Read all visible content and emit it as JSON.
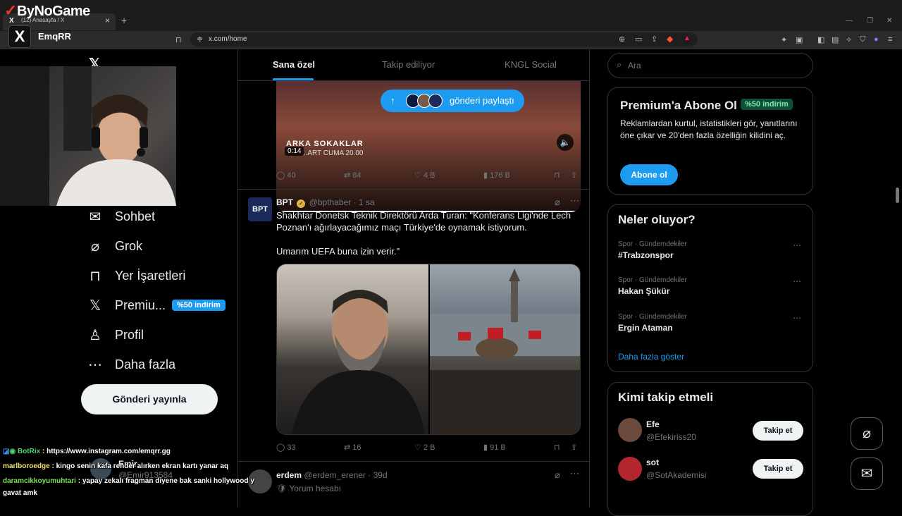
{
  "overlay": {
    "brand": "ByNoGame",
    "streamer_logo": "X",
    "streamer_name": "EmqRR"
  },
  "browser": {
    "tab_title": "(12) Anasayfa / X",
    "url": "x.com/home"
  },
  "nav": {
    "items": [
      {
        "label": "Sohbet",
        "icon": "envelope-icon"
      },
      {
        "label": "Grok",
        "icon": "grok-icon"
      },
      {
        "label": "Yer İşaretleri",
        "icon": "bookmark-icon"
      },
      {
        "label": "Premiu...",
        "icon": "x-icon"
      },
      {
        "label": "Profil",
        "icon": "person-icon"
      },
      {
        "label": "Daha fazla",
        "icon": "more-circle-icon"
      }
    ],
    "premium_badge": "%50 indirim",
    "post_button": "Gönderi yayınla"
  },
  "feed": {
    "tabs": [
      "Sana özel",
      "Takip ediliyor",
      "KNGL Social"
    ],
    "video": {
      "share_pill": "gönderi paylaştı",
      "title": "ARKA SOKAKLAR",
      "subtitle": "...ART CUMA 20.00",
      "time": "0:14"
    },
    "post1_actions": {
      "replies": "40",
      "reposts": "84",
      "likes": "4 B",
      "views": "176 B"
    },
    "post2": {
      "avatar_text": "BPT",
      "name": "BPT",
      "handle": "@bpthaber",
      "time": "· 1 sa",
      "text1": "Shakhtar Donetsk Teknik Direktörü Arda Turan: \"Konferans Ligi'nde Lech Poznan'ı ağırlayacağımız maçı Türkiye'de oynamak istiyorum.",
      "text2": "Umarım UEFA buna izin verir.\"",
      "actions": {
        "replies": "33",
        "reposts": "16",
        "likes": "2 B",
        "views": "91 B"
      }
    },
    "post3": {
      "name": "erdem",
      "handle": "@erdem_erener",
      "time": "· 39d",
      "text": "Yorum hesabı"
    }
  },
  "sidebar": {
    "search_placeholder": "Ara",
    "premium": {
      "title": "Premium'a Abone Ol",
      "badge": "%50 indirim",
      "text": "Reklamlardan kurtul, istatistikleri gör, yanıtlarını öne çıkar ve 20'den fazla özelliğin kilidini aç.",
      "button": "Abone ol"
    },
    "trends": {
      "title": "Neler oluyor?",
      "items": [
        {
          "category": "Spor · Gündemdekiler",
          "name": "#Trabzonspor"
        },
        {
          "category": "Spor · Gündemdekiler",
          "name": "Hakan Şükür"
        },
        {
          "category": "Spor · Gündemdekiler",
          "name": "Ergin Ataman"
        }
      ],
      "show_more": "Daha fazla göster"
    },
    "who_to_follow": {
      "title": "Kimi takip etmeli",
      "items": [
        {
          "name": "Efe",
          "handle": "@Efekiriss20",
          "button": "Takip et",
          "avatar_color": "#6a4a3a"
        },
        {
          "name": "sot",
          "handle": "@SotAkademisi",
          "button": "Takip et",
          "avatar_color": "#b3262e"
        }
      ]
    }
  },
  "account": {
    "name": "Emir",
    "handle": "@Emir913584"
  },
  "chat": [
    {
      "user": "BotRix",
      "message": ": https://www.instagram.com/emqrr.gg"
    },
    {
      "user": "marlboroedge",
      "message": ": kingo senin kafa render alırken ekran kartı yanar aq"
    },
    {
      "user": "daramcikkoyumuhtari",
      "message": ": yapay zekalı fragman diyene bak sanki hollywood y"
    },
    {
      "user": "",
      "message": "gavat amk"
    }
  ],
  "colors": {
    "accent": "#1d9bf0",
    "background": "#000000",
    "border": "#2f3336",
    "muted": "#71767b"
  }
}
